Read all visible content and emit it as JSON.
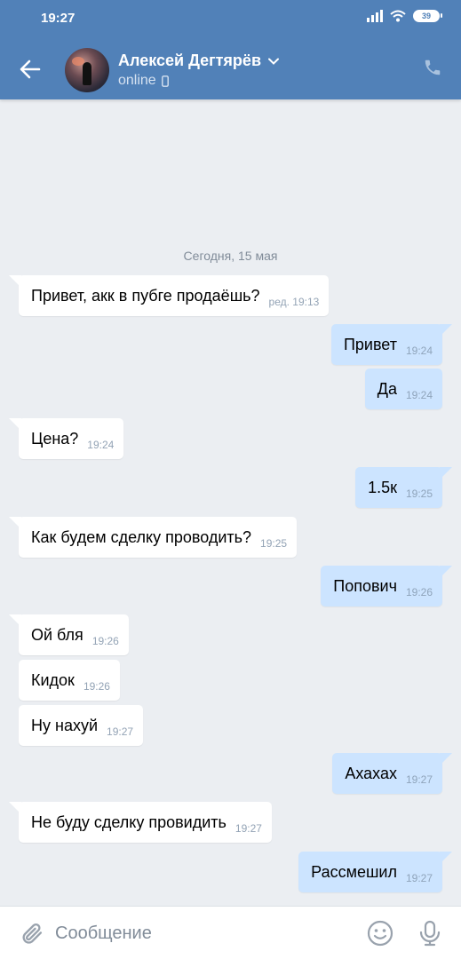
{
  "status_bar": {
    "time": "19:27",
    "battery": "39"
  },
  "header": {
    "contact_name": "Алексей Дегтярёв",
    "contact_status": "online"
  },
  "chat": {
    "date_separator": "Сегодня, 15 мая",
    "messages": [
      {
        "dir": "in",
        "text": "Привет, акк в пубге продаёшь?",
        "meta": "ред. 19:13"
      },
      {
        "dir": "out",
        "text": "Привет",
        "meta": "19:24"
      },
      {
        "dir": "out",
        "text": "Да",
        "meta": "19:24"
      },
      {
        "dir": "in",
        "text": "Цена?",
        "meta": "19:24"
      },
      {
        "dir": "out",
        "text": "1.5к",
        "meta": "19:25"
      },
      {
        "dir": "in",
        "text": "Как будем сделку проводить?",
        "meta": "19:25"
      },
      {
        "dir": "out",
        "text": "Попович",
        "meta": "19:26"
      },
      {
        "dir": "in",
        "text": "Ой бля",
        "meta": "19:26"
      },
      {
        "dir": "in",
        "text": "Кидок",
        "meta": "19:26"
      },
      {
        "dir": "in",
        "text": "Ну нахуй",
        "meta": "19:27"
      },
      {
        "dir": "out",
        "text": "Ахахах",
        "meta": "19:27"
      },
      {
        "dir": "in",
        "text": "Не буду сделку провидить",
        "meta": "19:27"
      },
      {
        "dir": "out",
        "text": "Рассмешил",
        "meta": "19:27"
      }
    ]
  },
  "composer": {
    "placeholder": "Сообщение"
  },
  "colors": {
    "header_bg": "#5181b8",
    "chat_bg": "#ebeef2",
    "incoming_bubble": "#ffffff",
    "outgoing_bubble": "#cce4ff"
  },
  "icons": [
    "back-arrow-icon",
    "chevron-down-icon",
    "mobile-device-icon",
    "phone-icon",
    "paperclip-icon",
    "emoji-icon",
    "microphone-icon"
  ]
}
